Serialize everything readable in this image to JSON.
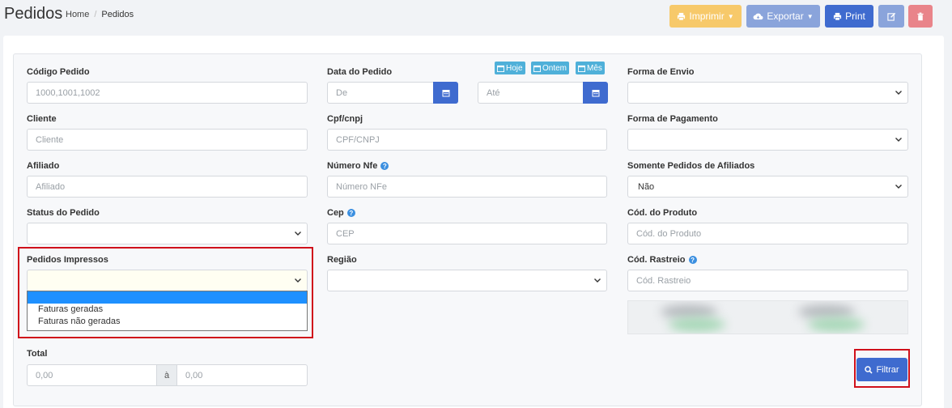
{
  "header": {
    "title": "Pedidos",
    "breadcrumb": [
      "Home",
      "Pedidos"
    ]
  },
  "toolbar": {
    "imprimir_label": "Imprimir",
    "exportar_label": "Exportar",
    "print_label": "Print"
  },
  "filters": {
    "codigo_pedido": {
      "label": "Código Pedido",
      "placeholder": "1000,1001,1002"
    },
    "data_pedido": {
      "label": "Data do Pedido",
      "from_placeholder": "De",
      "to_placeholder": "Até",
      "quick": [
        "Hoje",
        "Ontem",
        "Mês"
      ]
    },
    "forma_envio": {
      "label": "Forma de Envio",
      "value": ""
    },
    "cliente": {
      "label": "Cliente",
      "placeholder": "Cliente"
    },
    "cpf_cnpj": {
      "label": "Cpf/cnpj",
      "placeholder": "CPF/CNPJ"
    },
    "forma_pagamento": {
      "label": "Forma de Pagamento",
      "value": ""
    },
    "afiliado": {
      "label": "Afiliado",
      "placeholder": "Afiliado"
    },
    "numero_nfe": {
      "label": "Número Nfe",
      "placeholder": "Número NFe"
    },
    "somente_afiliados": {
      "label": "Somente Pedidos de Afiliados",
      "value": "Não"
    },
    "status_pedido": {
      "label": "Status do Pedido",
      "value": ""
    },
    "cep": {
      "label": "Cep",
      "placeholder": "CEP"
    },
    "cod_produto": {
      "label": "Cód. do Produto",
      "placeholder": "Cód. do Produto"
    },
    "pedidos_impressos": {
      "label": "Pedidos Impressos",
      "value": "",
      "options": [
        "",
        "Faturas geradas",
        "Faturas não geradas"
      ]
    },
    "regiao": {
      "label": "Região",
      "value": ""
    },
    "cod_rastreio": {
      "label": "Cód. Rastreio",
      "placeholder": "Cód. Rastreio"
    },
    "total": {
      "label": "Total",
      "min_placeholder": "0,00",
      "separator": "à",
      "max_placeholder": "0,00"
    }
  },
  "actions": {
    "filtrar_label": "Filtrar"
  },
  "colors": {
    "primary": "#3f6bcf",
    "warning": "#f7c96a",
    "info": "#4fb0d9",
    "danger": "#e9848a",
    "highlight": "#d0111b"
  }
}
